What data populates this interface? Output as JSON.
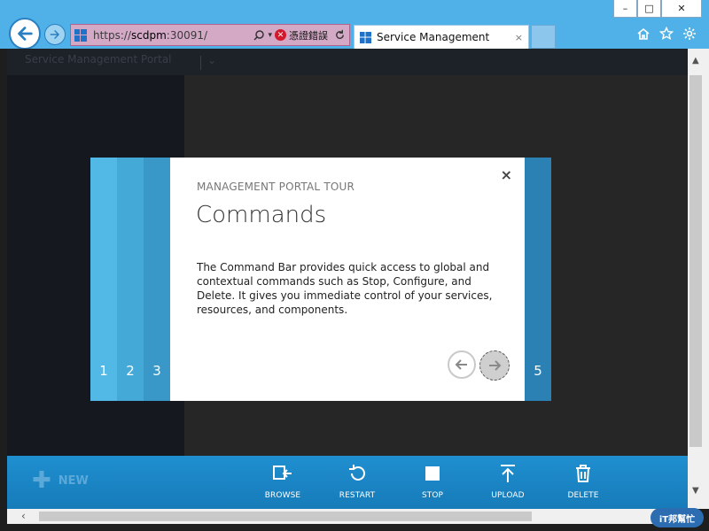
{
  "browser": {
    "window_controls": [
      "–",
      "□",
      "✕"
    ],
    "address": {
      "url_prefix": "https://",
      "url_host": "scdpm",
      "url_suffix": ":30091/",
      "cert_error_text": "憑證錯誤"
    },
    "tab": {
      "title": "Service Management",
      "close": "×"
    }
  },
  "portal": {
    "title": "Service Management Portal"
  },
  "modal": {
    "eyebrow": "MANAGEMENT PORTAL TOUR",
    "heading": "Commands",
    "body": "The Command Bar provides quick access to global and contextual commands such as Stop, Configure, and Delete. It gives you immediate control of your services, resources, and components.",
    "close": "×",
    "steps": [
      "1",
      "2",
      "3",
      "5"
    ]
  },
  "command_bar": {
    "new_label": "NEW",
    "commands": [
      {
        "label": "BROWSE",
        "icon": "browse-icon"
      },
      {
        "label": "RESTART",
        "icon": "restart-icon"
      },
      {
        "label": "STOP",
        "icon": "stop-icon"
      },
      {
        "label": "UPLOAD",
        "icon": "upload-icon"
      },
      {
        "label": "DELETE",
        "icon": "delete-icon"
      }
    ]
  },
  "watermark": {
    "text": "iT邦幫忙"
  }
}
